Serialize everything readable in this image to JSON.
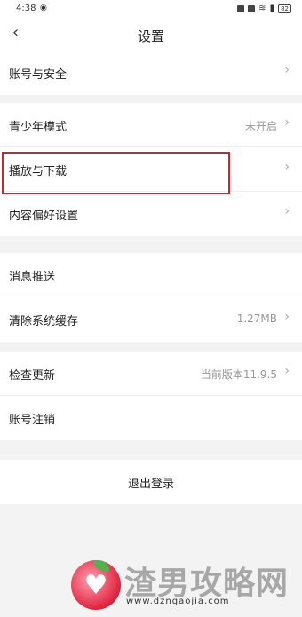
{
  "status_bar": {
    "time": "4:38",
    "battery": "82"
  },
  "header": {
    "back_icon": "chevron-left-icon",
    "title": "设置"
  },
  "groups": [
    [
      {
        "label": "账号与安全",
        "value": "",
        "chevron": true
      }
    ],
    [
      {
        "label": "青少年模式",
        "value": "未开启",
        "chevron": true
      },
      {
        "label": "播放与下载",
        "value": "",
        "chevron": true
      },
      {
        "label": "内容偏好设置",
        "value": "",
        "chevron": true
      }
    ],
    [
      {
        "label": "消息推送",
        "value": "",
        "chevron": false
      },
      {
        "label": "清除系统缓存",
        "value": "1.27MB",
        "chevron": true
      }
    ],
    [
      {
        "label": "检查更新",
        "value": "当前版本11.9.5",
        "chevron": true
      },
      {
        "label": "账号注销",
        "value": "",
        "chevron": false
      }
    ]
  ],
  "logout": {
    "label": "退出登录"
  },
  "watermark": {
    "text": "渣男攻略网",
    "url": "www.dzngaojia.com"
  },
  "colors": {
    "highlight": "#d8202b",
    "background": "#f3f3f3"
  }
}
